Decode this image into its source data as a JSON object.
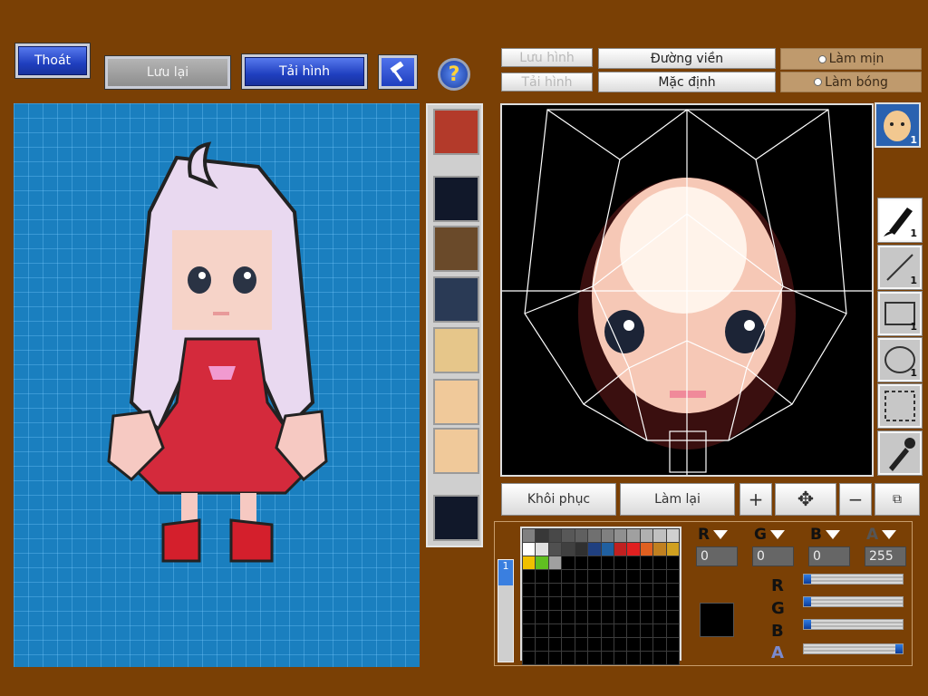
{
  "top_left": {
    "exit_label": "Thoát",
    "save_label": "Lưu lại",
    "load_label": "Tải hình"
  },
  "editor": {
    "save_image": "Lưu hình",
    "load_image": "Tải hình",
    "outline": "Đường viền",
    "default": "Mặc định",
    "smooth": "Làm mịn",
    "shading": "Làm bóng",
    "restore": "Khôi phục",
    "redo": "Làm lại",
    "face_badge": "1",
    "tool_counts": [
      "1",
      "1",
      "1",
      "1"
    ]
  },
  "thumbnails": [
    {
      "name": "red-hair-character-thumb"
    },
    {
      "name": "empty-slot"
    },
    {
      "name": "dragon-character-thumb"
    },
    {
      "name": "armored-character-thumb"
    },
    {
      "name": "face-thumb-1"
    },
    {
      "name": "face-thumb-2"
    },
    {
      "name": "face-thumb-3"
    },
    {
      "name": "empty-slot"
    }
  ],
  "color": {
    "r": "0",
    "g": "0",
    "b": "0",
    "a": "255",
    "r_label": "R",
    "g_label": "G",
    "b_label": "B",
    "a_label": "A",
    "current": "#000000",
    "levels": {
      "r": 0.0,
      "g": 0.0,
      "b": 0.0,
      "a": 1.0
    }
  },
  "palette_colors": [
    "#808080",
    "#383838",
    "#484848",
    "#585858",
    "#606060",
    "#707070",
    "#808080",
    "#909090",
    "#a0a0a0",
    "#b0b0b0",
    "#c0c0c0",
    "#d0d0d0",
    "#ffffff",
    "#e0e0e0",
    "#505050",
    "#404040",
    "#303030",
    "#204080",
    "#2060a0",
    "#c02020",
    "#e02020",
    "#e06020",
    "#c08020",
    "#d0a020",
    "#f0c000",
    "#60c020",
    "#a0a0a0",
    "#000000",
    "#000000",
    "#000000",
    "#000000",
    "#000000",
    "#000000",
    "#000000",
    "#000000",
    "#000000"
  ],
  "side_tabs": [
    "1"
  ]
}
